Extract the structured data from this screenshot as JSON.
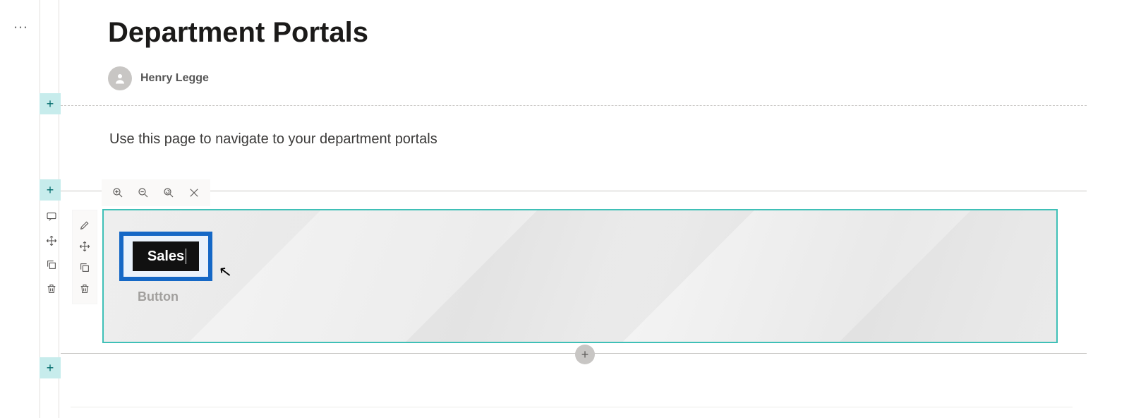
{
  "page": {
    "title": "Department Portals",
    "author": "Henry Legge",
    "intro": "Use this page to navigate to your department portals"
  },
  "controls": {
    "ellipsis": "…",
    "rail_plus": "+",
    "round_add": "+"
  },
  "zoom_toolbar": {
    "zoom_in": "zoom-in",
    "zoom_out": "zoom-out",
    "zoom_reset": "zoom-reset",
    "close": "close"
  },
  "section_tools": {
    "comment": "comment",
    "move": "move",
    "duplicate": "duplicate",
    "delete": "delete"
  },
  "webpart_tools": {
    "edit": "edit",
    "move": "move",
    "duplicate": "duplicate",
    "delete": "delete"
  },
  "button_webpart": {
    "editing_label": "Sales",
    "placeholder": "Button"
  }
}
